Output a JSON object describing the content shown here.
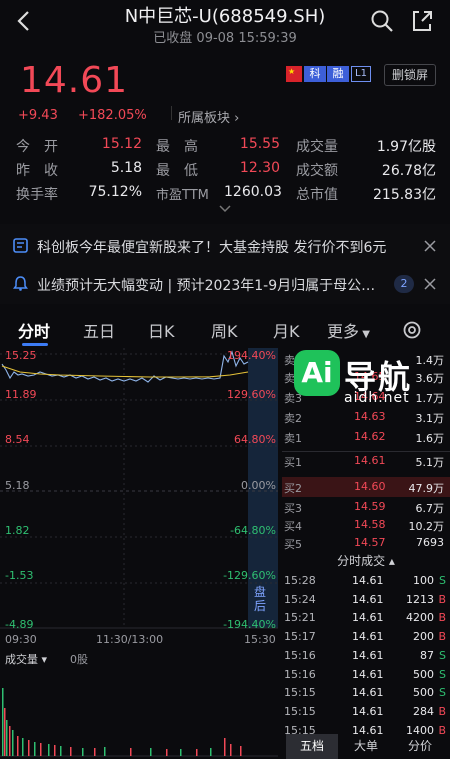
{
  "header": {
    "title": "N中巨芯-U(688549.SH)",
    "status": "已收盘",
    "date": "09-08",
    "time": "15:59:39"
  },
  "quote": {
    "price": "14.61",
    "change": "+9.43",
    "change_pct": "+182.05%",
    "sector_label": "所属板块",
    "badges": {
      "market": "科",
      "margin": "融",
      "level": "L1"
    },
    "lock_button": "删锁屏",
    "stats": [
      [
        {
          "label": "今　开",
          "value": "15.12"
        },
        {
          "label": "最　高",
          "value": "15.55"
        },
        {
          "label": "成交量",
          "value": "1.97亿股"
        }
      ],
      [
        {
          "label": "昨　收",
          "value": "5.18"
        },
        {
          "label": "最　低",
          "value": "12.30"
        },
        {
          "label": "成交额",
          "value": "26.78亿"
        }
      ],
      [
        {
          "label": "换手率",
          "value": "75.12%"
        },
        {
          "label": "市盈TTM",
          "value": "1260.03"
        },
        {
          "label": "总市值",
          "value": "215.83亿"
        }
      ]
    ]
  },
  "notices": [
    {
      "text": "科创板今年最便宜新股来了！大基金持股 发行价不到6元"
    },
    {
      "text": "业绩预计无大幅变动 | 预计2023年1-9月归属于母公…",
      "count": "2"
    }
  ],
  "tabs": [
    "分时",
    "五日",
    "日K",
    "周K",
    "月K",
    "更多"
  ],
  "chart": {
    "left_ticks": [
      "15.25",
      "11.89",
      "8.54",
      "5.18",
      "1.82",
      "-1.53",
      "-4.89"
    ],
    "right_ticks": [
      "194.40%",
      "129.60%",
      "64.80%",
      "0.00%",
      "-64.80%",
      "-129.60%",
      "-194.40%"
    ],
    "times": [
      "09:30",
      "11:30/13:00",
      "15:30"
    ],
    "side_label": "盘后",
    "volume_label": "成交量",
    "volume_value": "0股",
    "price_path_note": ""
  },
  "orderbook": {
    "asks": [
      {
        "label": "卖5",
        "price": "",
        "vol": "1.4万"
      },
      {
        "label": "卖4",
        "price": "14.65",
        "vol": "3.6万"
      },
      {
        "label": "卖3",
        "price": "14.64",
        "vol": "1.7万"
      },
      {
        "label": "卖2",
        "price": "14.63",
        "vol": "3.1万"
      },
      {
        "label": "卖1",
        "price": "14.62",
        "vol": "1.6万"
      }
    ],
    "bids": [
      {
        "label": "买1",
        "price": "14.61",
        "vol": "5.1万"
      },
      {
        "label": "买2",
        "price": "14.60",
        "vol": "47.9万"
      },
      {
        "label": "买3",
        "price": "14.59",
        "vol": "6.7万"
      },
      {
        "label": "买4",
        "price": "14.58",
        "vol": "10.2万"
      },
      {
        "label": "买5",
        "price": "14.57",
        "vol": "7693"
      }
    ],
    "trades_title": "分时成交",
    "trades": [
      {
        "t": "15:28",
        "p": "14.61",
        "v": "100",
        "s": "S"
      },
      {
        "t": "15:24",
        "p": "14.61",
        "v": "1213",
        "s": "B"
      },
      {
        "t": "15:21",
        "p": "14.61",
        "v": "4200",
        "s": "B"
      },
      {
        "t": "15:17",
        "p": "14.61",
        "v": "200",
        "s": "B"
      },
      {
        "t": "15:16",
        "p": "14.61",
        "v": "87",
        "s": "S"
      },
      {
        "t": "15:16",
        "p": "14.61",
        "v": "500",
        "s": "S"
      },
      {
        "t": "15:15",
        "p": "14.61",
        "v": "500",
        "s": "S"
      },
      {
        "t": "15:15",
        "p": "14.61",
        "v": "284",
        "s": "B"
      },
      {
        "t": "15:15",
        "p": "14.61",
        "v": "1400",
        "s": "B"
      }
    ],
    "bottom_tabs": [
      "五档",
      "大单",
      "分价"
    ]
  },
  "watermark": {
    "logo": "Ai",
    "text": "导航",
    "sub": "aidh.net"
  },
  "colors": {
    "up": "#f24957",
    "down": "#2fbf71",
    "accent": "#3d7cf5",
    "bg": "#0b0b0e"
  }
}
